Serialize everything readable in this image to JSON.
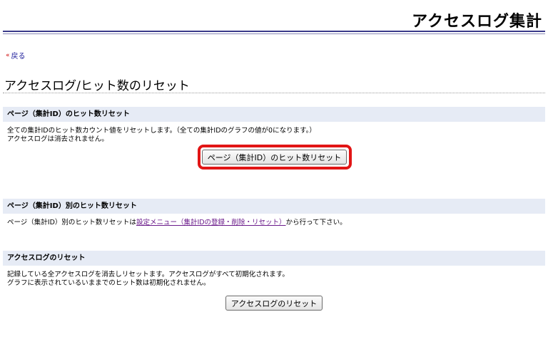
{
  "header": {
    "title": "アクセスログ集計"
  },
  "nav": {
    "back_label": "戻る",
    "back_arrow": "«"
  },
  "page": {
    "heading": "アクセスログ/ヒット数のリセット"
  },
  "sections": [
    {
      "title": "ページ（集計ID）のヒット数リセット",
      "lines": [
        "全ての集計IDのヒット数カウント値をリセットします。（全ての集計IDのグラフの値が0になります。）",
        "アクセスログは消去されません。"
      ],
      "button_label": "ページ（集計ID）のヒット数リセット"
    },
    {
      "title": "ページ（集計ID）別のヒット数リセット",
      "text_prefix": "ページ（集計ID）別のヒット数リセットは",
      "link_text": "設定メニュー（集計IDの登録・削除・リセット）",
      "text_suffix": "から行って下さい。"
    },
    {
      "title": "アクセスログのリセット",
      "lines": [
        "記録している全アクセスログを消去しリセットます。アクセスログがすべて初期化されます。",
        "グラフに表示されているいままでのヒット数は初期化されません。"
      ],
      "button_label": "アクセスログのリセット"
    }
  ],
  "colors": {
    "highlight": "#e21515",
    "section_bg": "#e6ebf5",
    "link": "#6a1a8a",
    "rule": "#3a3a8a"
  }
}
